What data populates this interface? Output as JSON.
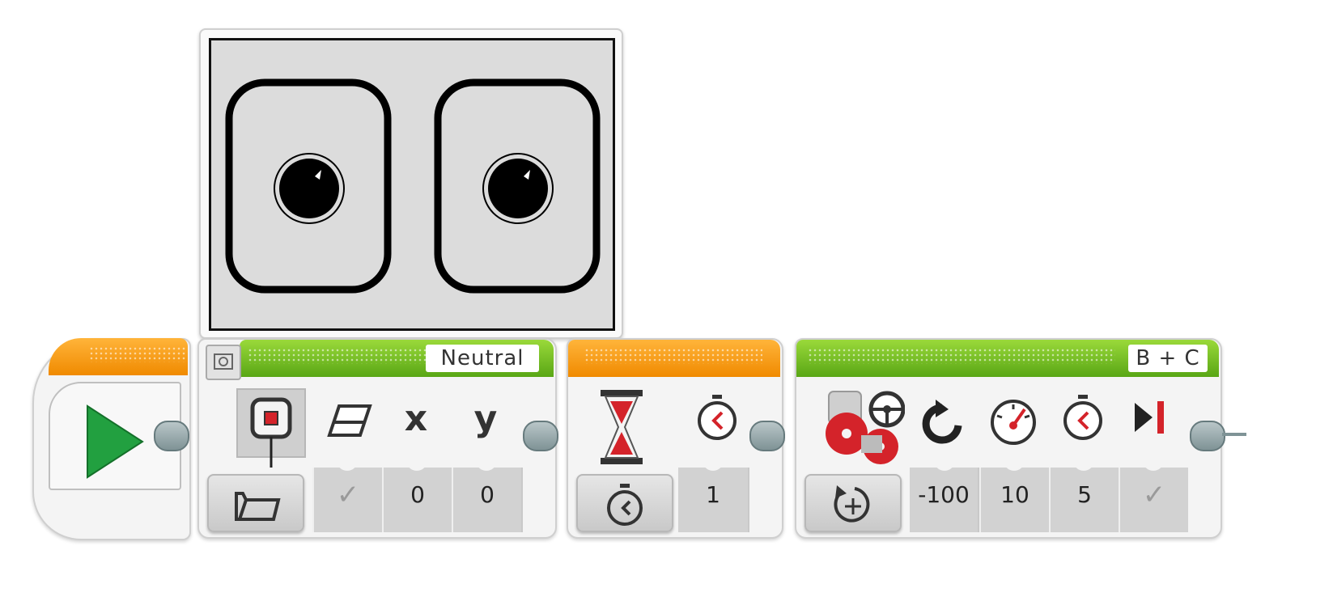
{
  "display_preview": {
    "image_name": "eyes-neutral"
  },
  "start_block": {
    "icon": "play-icon"
  },
  "display_block": {
    "file_name": "Neutral",
    "mode_icon": "display-image-icon",
    "file_button_icon": "folder-icon",
    "params": [
      {
        "icon": "eraser-icon",
        "header": "",
        "value": "✓"
      },
      {
        "icon": "x-icon",
        "header": "x",
        "value": "0"
      },
      {
        "icon": "y-icon",
        "header": "y",
        "value": "0"
      }
    ]
  },
  "wait_block": {
    "mode_icon": "hourglass-icon",
    "mode_button_icon": "timer-icon",
    "params": [
      {
        "icon": "stopwatch-icon",
        "value": "1"
      }
    ]
  },
  "steering_block": {
    "ports": "B + C",
    "mode_icon": "move-steering-icon",
    "mode_button_icon": "rotation-icon",
    "params": [
      {
        "icon": "steering-icon",
        "value": "-100"
      },
      {
        "icon": "power-icon",
        "value": "10"
      },
      {
        "icon": "seconds-icon",
        "value": "5"
      },
      {
        "icon": "brake-icon",
        "value": "✓"
      }
    ]
  },
  "colors": {
    "orange": "#f08a00",
    "green": "#59a615",
    "play_green": "#22a040",
    "red": "#d4232a"
  }
}
